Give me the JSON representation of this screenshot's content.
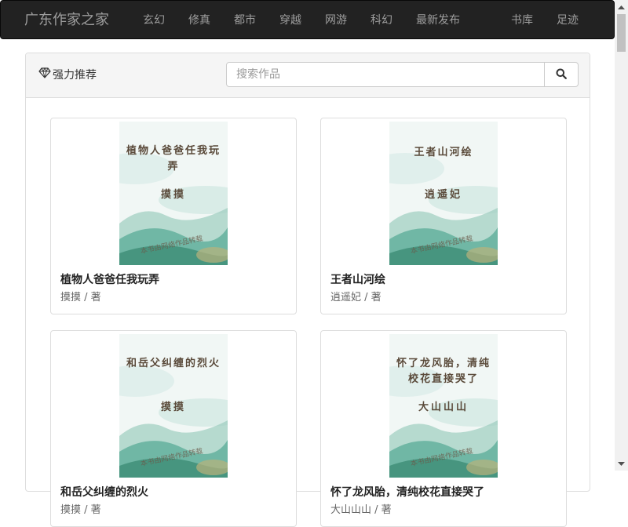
{
  "navbar": {
    "brand": "广东作家之家",
    "items": [
      {
        "label": "玄幻"
      },
      {
        "label": "修真"
      },
      {
        "label": "都市"
      },
      {
        "label": "穿越"
      },
      {
        "label": "网游"
      },
      {
        "label": "科幻"
      },
      {
        "label": "最新发布"
      }
    ],
    "right_items": [
      {
        "label": "书库"
      },
      {
        "label": "足迹"
      }
    ]
  },
  "panel": {
    "title": "强力推荐",
    "title_icon": "diamond-icon",
    "search": {
      "placeholder": "搜索作品",
      "value": "",
      "button_icon": "search-icon"
    }
  },
  "books": [
    {
      "title": "植物人爸爸任我玩弄",
      "author": "摸摸 / 著",
      "cover_title": "植物人爸爸任我玩弄",
      "cover_author": "摸摸",
      "cover_stamp": "本书由网络作品转载"
    },
    {
      "title": "王者山河绘",
      "author": "逍遥妃 / 著",
      "cover_title": "王者山河绘",
      "cover_author": "逍遥妃",
      "cover_stamp": "本书由网络作品转载"
    },
    {
      "title": "和岳父纠缠的烈火",
      "author": "摸摸 / 著",
      "cover_title": "和岳父纠缠的烈火",
      "cover_author": "摸摸",
      "cover_stamp": "本书由网络作品转载"
    },
    {
      "title": "怀了龙风胎，清纯校花直接哭了",
      "author": "大山山山 / 著",
      "cover_title": "怀了龙风胎，清纯校花直接哭了",
      "cover_author": "大山山山",
      "cover_stamp": "本书由网络作品转载"
    }
  ],
  "colors": {
    "navbar_bg": "#222222",
    "navbar_text": "#9d9d9d",
    "panel_head_bg": "#f5f5f5",
    "border": "#dddddd"
  }
}
